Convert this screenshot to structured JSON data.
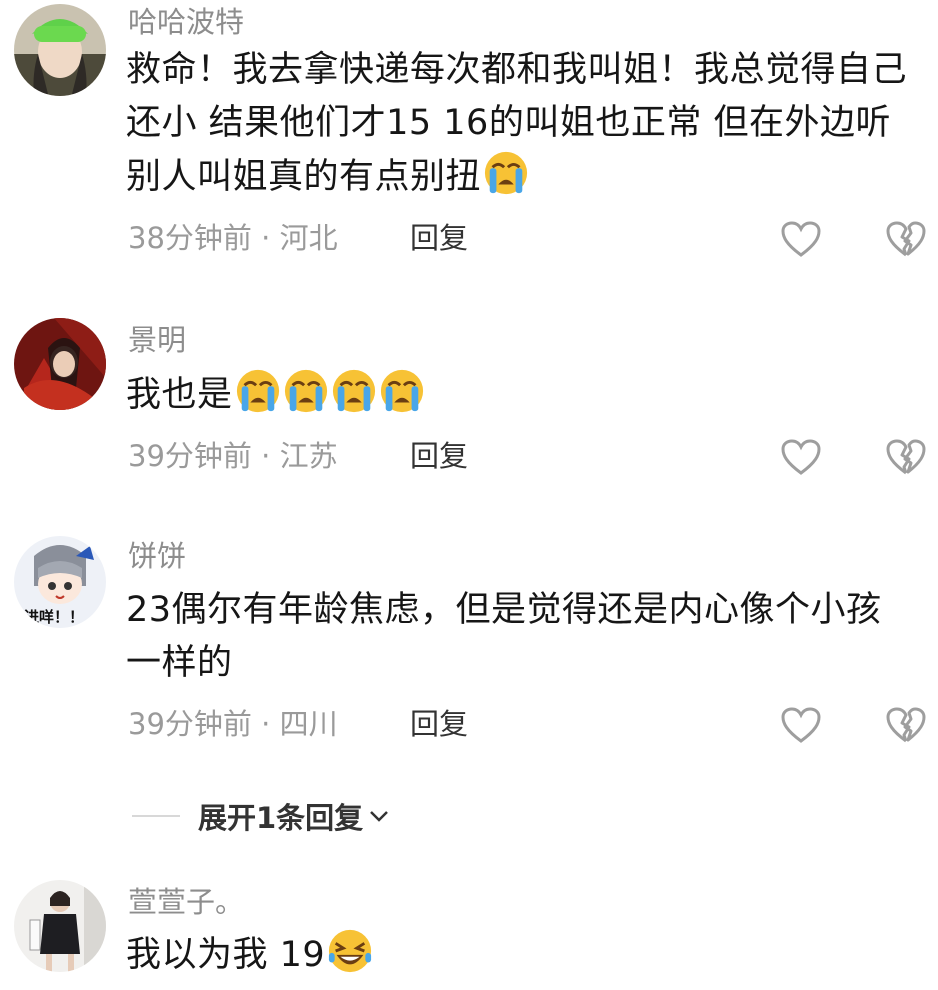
{
  "comments": [
    {
      "username": "哈哈波特",
      "text": "救命！我去拿快递每次都和我叫姐！我总觉得自己还小 结果他们才15 16的叫姐也正常 但在外边听别人叫姐真的有点别扭",
      "emoji_count": 1,
      "time": "38分钟前",
      "location": "河北",
      "reply_label": "回复"
    },
    {
      "username": "景明",
      "text": "我也是",
      "emoji_count": 4,
      "time": "39分钟前",
      "location": "江苏",
      "reply_label": "回复"
    },
    {
      "username": "饼饼",
      "text": "23偶尔有年龄焦虑，但是觉得还是内心像个小孩一样的",
      "emoji_count": 0,
      "time": "39分钟前",
      "location": "四川",
      "reply_label": "回复",
      "avatar_text": "进咩！！"
    },
    {
      "username": "萱萱子。",
      "text": "我以为我 19",
      "emoji_count": 1
    }
  ],
  "expand_replies_label": "展开1条回复",
  "icons": {
    "like": "heart-outline-icon",
    "dislike": "broken-heart-icon",
    "emoji_crying": "loudly-crying-face-icon",
    "emoji_laughing": "rolling-laughing-face-icon",
    "chevron": "chevron-down-icon"
  },
  "colors": {
    "text": "#161616",
    "muted": "#9a9a9a",
    "emoji_yellow": "#f7c235",
    "tear_blue": "#49a6e8"
  }
}
